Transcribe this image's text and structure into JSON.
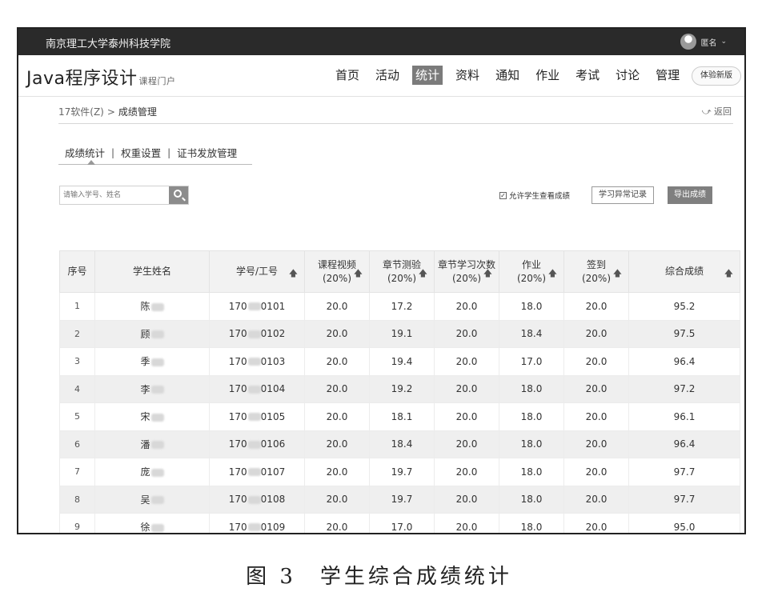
{
  "topbar": {
    "school": "南京理工大学泰州科技学院",
    "user": "匿名"
  },
  "header": {
    "course_title": "Java程序设计",
    "course_sub": "课程门户",
    "nav": [
      "首页",
      "活动",
      "统计",
      "资料",
      "通知",
      "作业",
      "考试",
      "讨论",
      "管理"
    ],
    "active_nav": "统计",
    "trial_button": "体验新版"
  },
  "breadcrumb": {
    "class": "17软件(Z)",
    "sep": ">",
    "current": "成绩管理",
    "back": "返回"
  },
  "subtabs": [
    "成绩统计",
    "权重设置",
    "证书发放管理"
  ],
  "toolbar": {
    "search_placeholder": "请输入学号、姓名",
    "allow_label": "允许学生查看成绩",
    "abnormal_button": "学习异常记录",
    "export_button": "导出成绩"
  },
  "table": {
    "headers": {
      "index": "序号",
      "name": "学生姓名",
      "id": "学号/工号",
      "video": "课程视频",
      "video_w": "(20%)",
      "quiz": "章节测验",
      "quiz_w": "(20%)",
      "study": "章节学习次数",
      "study_w": "(20%)",
      "homework": "作业",
      "homework_w": "(20%)",
      "signin": "签到",
      "signin_w": "(20%)",
      "total": "综合成绩"
    },
    "rows": [
      {
        "index": "1",
        "name": "陈",
        "id_a": "170",
        "id_b": "0101",
        "video": "20.0",
        "quiz": "17.2",
        "study": "20.0",
        "homework": "18.0",
        "signin": "20.0",
        "total": "95.2"
      },
      {
        "index": "2",
        "name": "顾",
        "id_a": "170",
        "id_b": "0102",
        "video": "20.0",
        "quiz": "19.1",
        "study": "20.0",
        "homework": "18.4",
        "signin": "20.0",
        "total": "97.5"
      },
      {
        "index": "3",
        "name": "季",
        "id_a": "170",
        "id_b": "0103",
        "video": "20.0",
        "quiz": "19.4",
        "study": "20.0",
        "homework": "17.0",
        "signin": "20.0",
        "total": "96.4"
      },
      {
        "index": "4",
        "name": "李",
        "id_a": "170",
        "id_b": "0104",
        "video": "20.0",
        "quiz": "19.2",
        "study": "20.0",
        "homework": "18.0",
        "signin": "20.0",
        "total": "97.2"
      },
      {
        "index": "5",
        "name": "宋",
        "id_a": "170",
        "id_b": "0105",
        "video": "20.0",
        "quiz": "18.1",
        "study": "20.0",
        "homework": "18.0",
        "signin": "20.0",
        "total": "96.1"
      },
      {
        "index": "6",
        "name": "潘",
        "id_a": "170",
        "id_b": "0106",
        "video": "20.0",
        "quiz": "18.4",
        "study": "20.0",
        "homework": "18.0",
        "signin": "20.0",
        "total": "96.4"
      },
      {
        "index": "7",
        "name": "庞",
        "id_a": "170",
        "id_b": "0107",
        "video": "20.0",
        "quiz": "19.7",
        "study": "20.0",
        "homework": "18.0",
        "signin": "20.0",
        "total": "97.7"
      },
      {
        "index": "8",
        "name": "吴",
        "id_a": "170",
        "id_b": "0108",
        "video": "20.0",
        "quiz": "19.7",
        "study": "20.0",
        "homework": "18.0",
        "signin": "20.0",
        "total": "97.7"
      },
      {
        "index": "9",
        "name": "徐",
        "id_a": "170",
        "id_b": "0109",
        "video": "20.0",
        "quiz": "17.0",
        "study": "20.0",
        "homework": "18.0",
        "signin": "20.0",
        "total": "95.0"
      }
    ]
  },
  "caption": "图 3　学生综合成绩统计"
}
